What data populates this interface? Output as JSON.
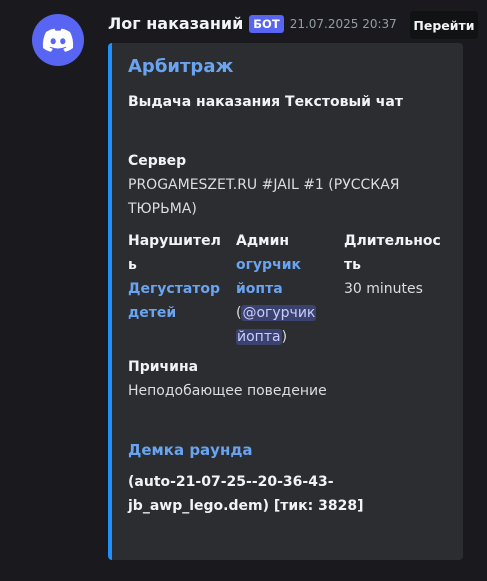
{
  "message": {
    "author": "Лог наказаний",
    "bot_badge": "БОТ",
    "timestamp": "21.07.2025 20:37",
    "goto_label": "Перейти"
  },
  "embed": {
    "title": "Арбитраж",
    "description": "Выдача наказания Текстовый чат",
    "accent_color": "#1e90ff",
    "server": {
      "name": "Сервер",
      "value_line1": "PROGAMESZET.RU #JAIL #1 (РУССКАЯ",
      "value_line2": "ТЮРЬМА)"
    },
    "violator": {
      "name_line1": "Нарушител",
      "name_line2": "ь",
      "value_line1": "Дегустатор",
      "value_line2": "детей"
    },
    "admin": {
      "name": "Админ",
      "value_line1": "огурчик",
      "value_line2": "йопта",
      "mention_open": "(",
      "mention_line1": "@огурчик",
      "mention_line2": "йопта",
      "mention_close": ")"
    },
    "duration": {
      "name_line1": "Длительнос",
      "name_line2": "ть",
      "value": "30 minutes"
    },
    "reason": {
      "name": "Причина",
      "value": "Неподобающее поведение"
    },
    "demo": {
      "name": "Демка раунда",
      "value_line1": "(auto-21-07-25--20-36-43-",
      "value_line2": "jb_awp_lego.dem) [тик: 3828]"
    }
  },
  "icons": {
    "avatar": "discord-logo-icon"
  }
}
